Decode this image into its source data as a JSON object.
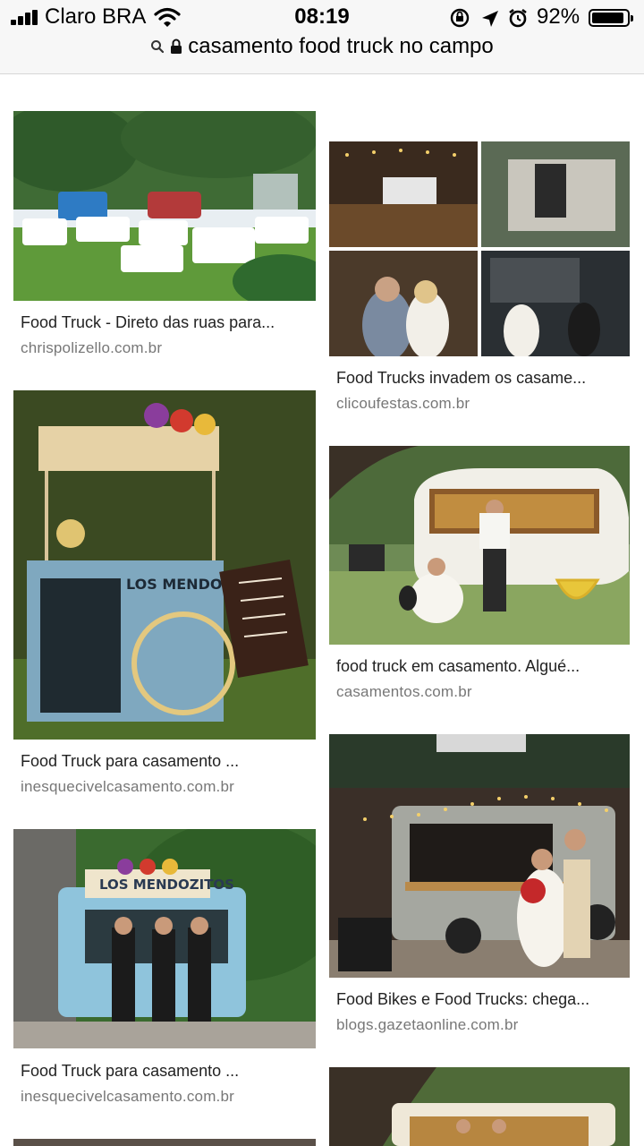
{
  "status_bar": {
    "carrier": "Claro BRA",
    "time": "08:19",
    "battery": "92%",
    "battery_level": 0.92
  },
  "url_bar": {
    "query": "casamento food truck no campo"
  },
  "results": [
    {
      "title": "Food Truck - Direto das ruas para...",
      "source": "chrispolizello.com.br"
    },
    {
      "title": "Food Trucks invadem os casame...",
      "source": "clicoufestas.com.br"
    },
    {
      "title": "Food Truck para casamento ...",
      "source": "inesquecivelcasamento.com.br"
    },
    {
      "title": "food truck em casamento. Algué...",
      "source": "casamentos.com.br"
    },
    {
      "title": "Food Truck para casamento ...",
      "source": "inesquecivelcasamento.com.br"
    },
    {
      "title": "Food Bikes e Food Trucks: chega...",
      "source": "blogs.gazetaonline.com.br"
    }
  ],
  "image_text": {
    "cart_sign": "LOS MENDOZITOS",
    "trailer_sign": "LOS MENDOZITOS"
  }
}
